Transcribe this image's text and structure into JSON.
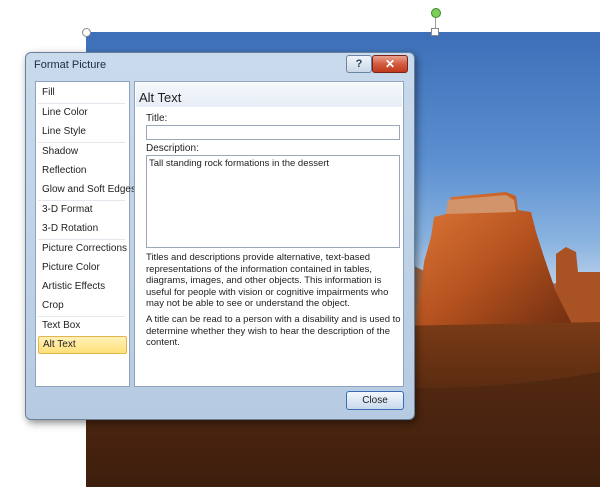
{
  "window": {
    "title": "Format Picture",
    "help_label": "?",
    "close_label": "✕"
  },
  "nav": {
    "items": [
      "Fill",
      "Line Color",
      "Line Style",
      "Shadow",
      "Reflection",
      "Glow and Soft Edges",
      "3-D Format",
      "3-D Rotation",
      "Picture Corrections",
      "Picture Color",
      "Artistic Effects",
      "Crop",
      "Text Box",
      "Alt Text"
    ],
    "selected": "Alt Text"
  },
  "panel": {
    "heading": "Alt Text",
    "title_label": "Title:",
    "title_value": "",
    "description_label": "Description:",
    "description_value": "Tall standing rock formations in the dessert",
    "help_paragraph_1": "Titles and descriptions provide alternative, text-based representations of the information contained in tables, diagrams, images, and other objects. This information is useful for people with vision or cognitive impairments who may not be able to see or understand the object.",
    "help_paragraph_2": "A title can be read to a person with a disability and is used to determine whether they wish to hear the description of the content."
  },
  "buttons": {
    "close_label": "Close"
  },
  "colors": {
    "selected_bg": "#ffe07a",
    "accent": "#3b6bb0",
    "close_red": "#c0391c"
  },
  "icons": {
    "help": "help-icon",
    "close": "close-icon",
    "rotation": "rotation-handle-icon"
  }
}
